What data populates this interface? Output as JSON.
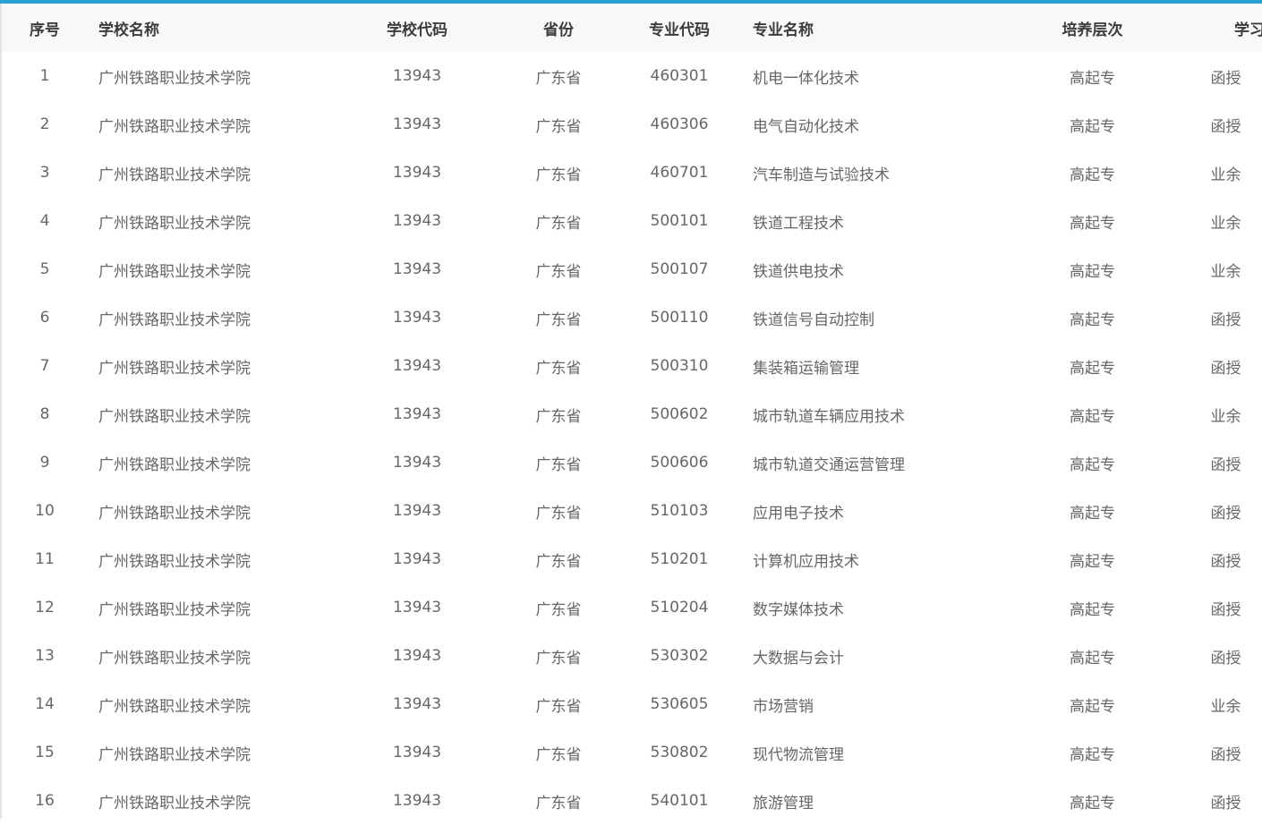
{
  "headers": {
    "index": "序号",
    "school_name": "学校名称",
    "school_code": "学校代码",
    "province": "省份",
    "major_code": "专业代码",
    "major_name": "专业名称",
    "level": "培养层次",
    "study_form": "学习形式"
  },
  "rows": [
    {
      "index": "1",
      "school_name": "广州铁路职业技术学院",
      "school_code": "13943",
      "province": "广东省",
      "major_code": "460301",
      "major_name": "机电一体化技术",
      "level": "高起专",
      "study_form": "函授"
    },
    {
      "index": "2",
      "school_name": "广州铁路职业技术学院",
      "school_code": "13943",
      "province": "广东省",
      "major_code": "460306",
      "major_name": "电气自动化技术",
      "level": "高起专",
      "study_form": "函授"
    },
    {
      "index": "3",
      "school_name": "广州铁路职业技术学院",
      "school_code": "13943",
      "province": "广东省",
      "major_code": "460701",
      "major_name": "汽车制造与试验技术",
      "level": "高起专",
      "study_form": "业余"
    },
    {
      "index": "4",
      "school_name": "广州铁路职业技术学院",
      "school_code": "13943",
      "province": "广东省",
      "major_code": "500101",
      "major_name": "铁道工程技术",
      "level": "高起专",
      "study_form": "业余"
    },
    {
      "index": "5",
      "school_name": "广州铁路职业技术学院",
      "school_code": "13943",
      "province": "广东省",
      "major_code": "500107",
      "major_name": "铁道供电技术",
      "level": "高起专",
      "study_form": "业余"
    },
    {
      "index": "6",
      "school_name": "广州铁路职业技术学院",
      "school_code": "13943",
      "province": "广东省",
      "major_code": "500110",
      "major_name": "铁道信号自动控制",
      "level": "高起专",
      "study_form": "函授"
    },
    {
      "index": "7",
      "school_name": "广州铁路职业技术学院",
      "school_code": "13943",
      "province": "广东省",
      "major_code": "500310",
      "major_name": "集装箱运输管理",
      "level": "高起专",
      "study_form": "函授"
    },
    {
      "index": "8",
      "school_name": "广州铁路职业技术学院",
      "school_code": "13943",
      "province": "广东省",
      "major_code": "500602",
      "major_name": "城市轨道车辆应用技术",
      "level": "高起专",
      "study_form": "业余"
    },
    {
      "index": "9",
      "school_name": "广州铁路职业技术学院",
      "school_code": "13943",
      "province": "广东省",
      "major_code": "500606",
      "major_name": "城市轨道交通运营管理",
      "level": "高起专",
      "study_form": "函授"
    },
    {
      "index": "10",
      "school_name": "广州铁路职业技术学院",
      "school_code": "13943",
      "province": "广东省",
      "major_code": "510103",
      "major_name": "应用电子技术",
      "level": "高起专",
      "study_form": "函授"
    },
    {
      "index": "11",
      "school_name": "广州铁路职业技术学院",
      "school_code": "13943",
      "province": "广东省",
      "major_code": "510201",
      "major_name": "计算机应用技术",
      "level": "高起专",
      "study_form": "函授"
    },
    {
      "index": "12",
      "school_name": "广州铁路职业技术学院",
      "school_code": "13943",
      "province": "广东省",
      "major_code": "510204",
      "major_name": "数字媒体技术",
      "level": "高起专",
      "study_form": "函授"
    },
    {
      "index": "13",
      "school_name": "广州铁路职业技术学院",
      "school_code": "13943",
      "province": "广东省",
      "major_code": "530302",
      "major_name": "大数据与会计",
      "level": "高起专",
      "study_form": "函授"
    },
    {
      "index": "14",
      "school_name": "广州铁路职业技术学院",
      "school_code": "13943",
      "province": "广东省",
      "major_code": "530605",
      "major_name": "市场营销",
      "level": "高起专",
      "study_form": "业余"
    },
    {
      "index": "15",
      "school_name": "广州铁路职业技术学院",
      "school_code": "13943",
      "province": "广东省",
      "major_code": "530802",
      "major_name": "现代物流管理",
      "level": "高起专",
      "study_form": "函授"
    },
    {
      "index": "16",
      "school_name": "广州铁路职业技术学院",
      "school_code": "13943",
      "province": "广东省",
      "major_code": "540101",
      "major_name": "旅游管理",
      "level": "高起专",
      "study_form": "函授"
    }
  ]
}
